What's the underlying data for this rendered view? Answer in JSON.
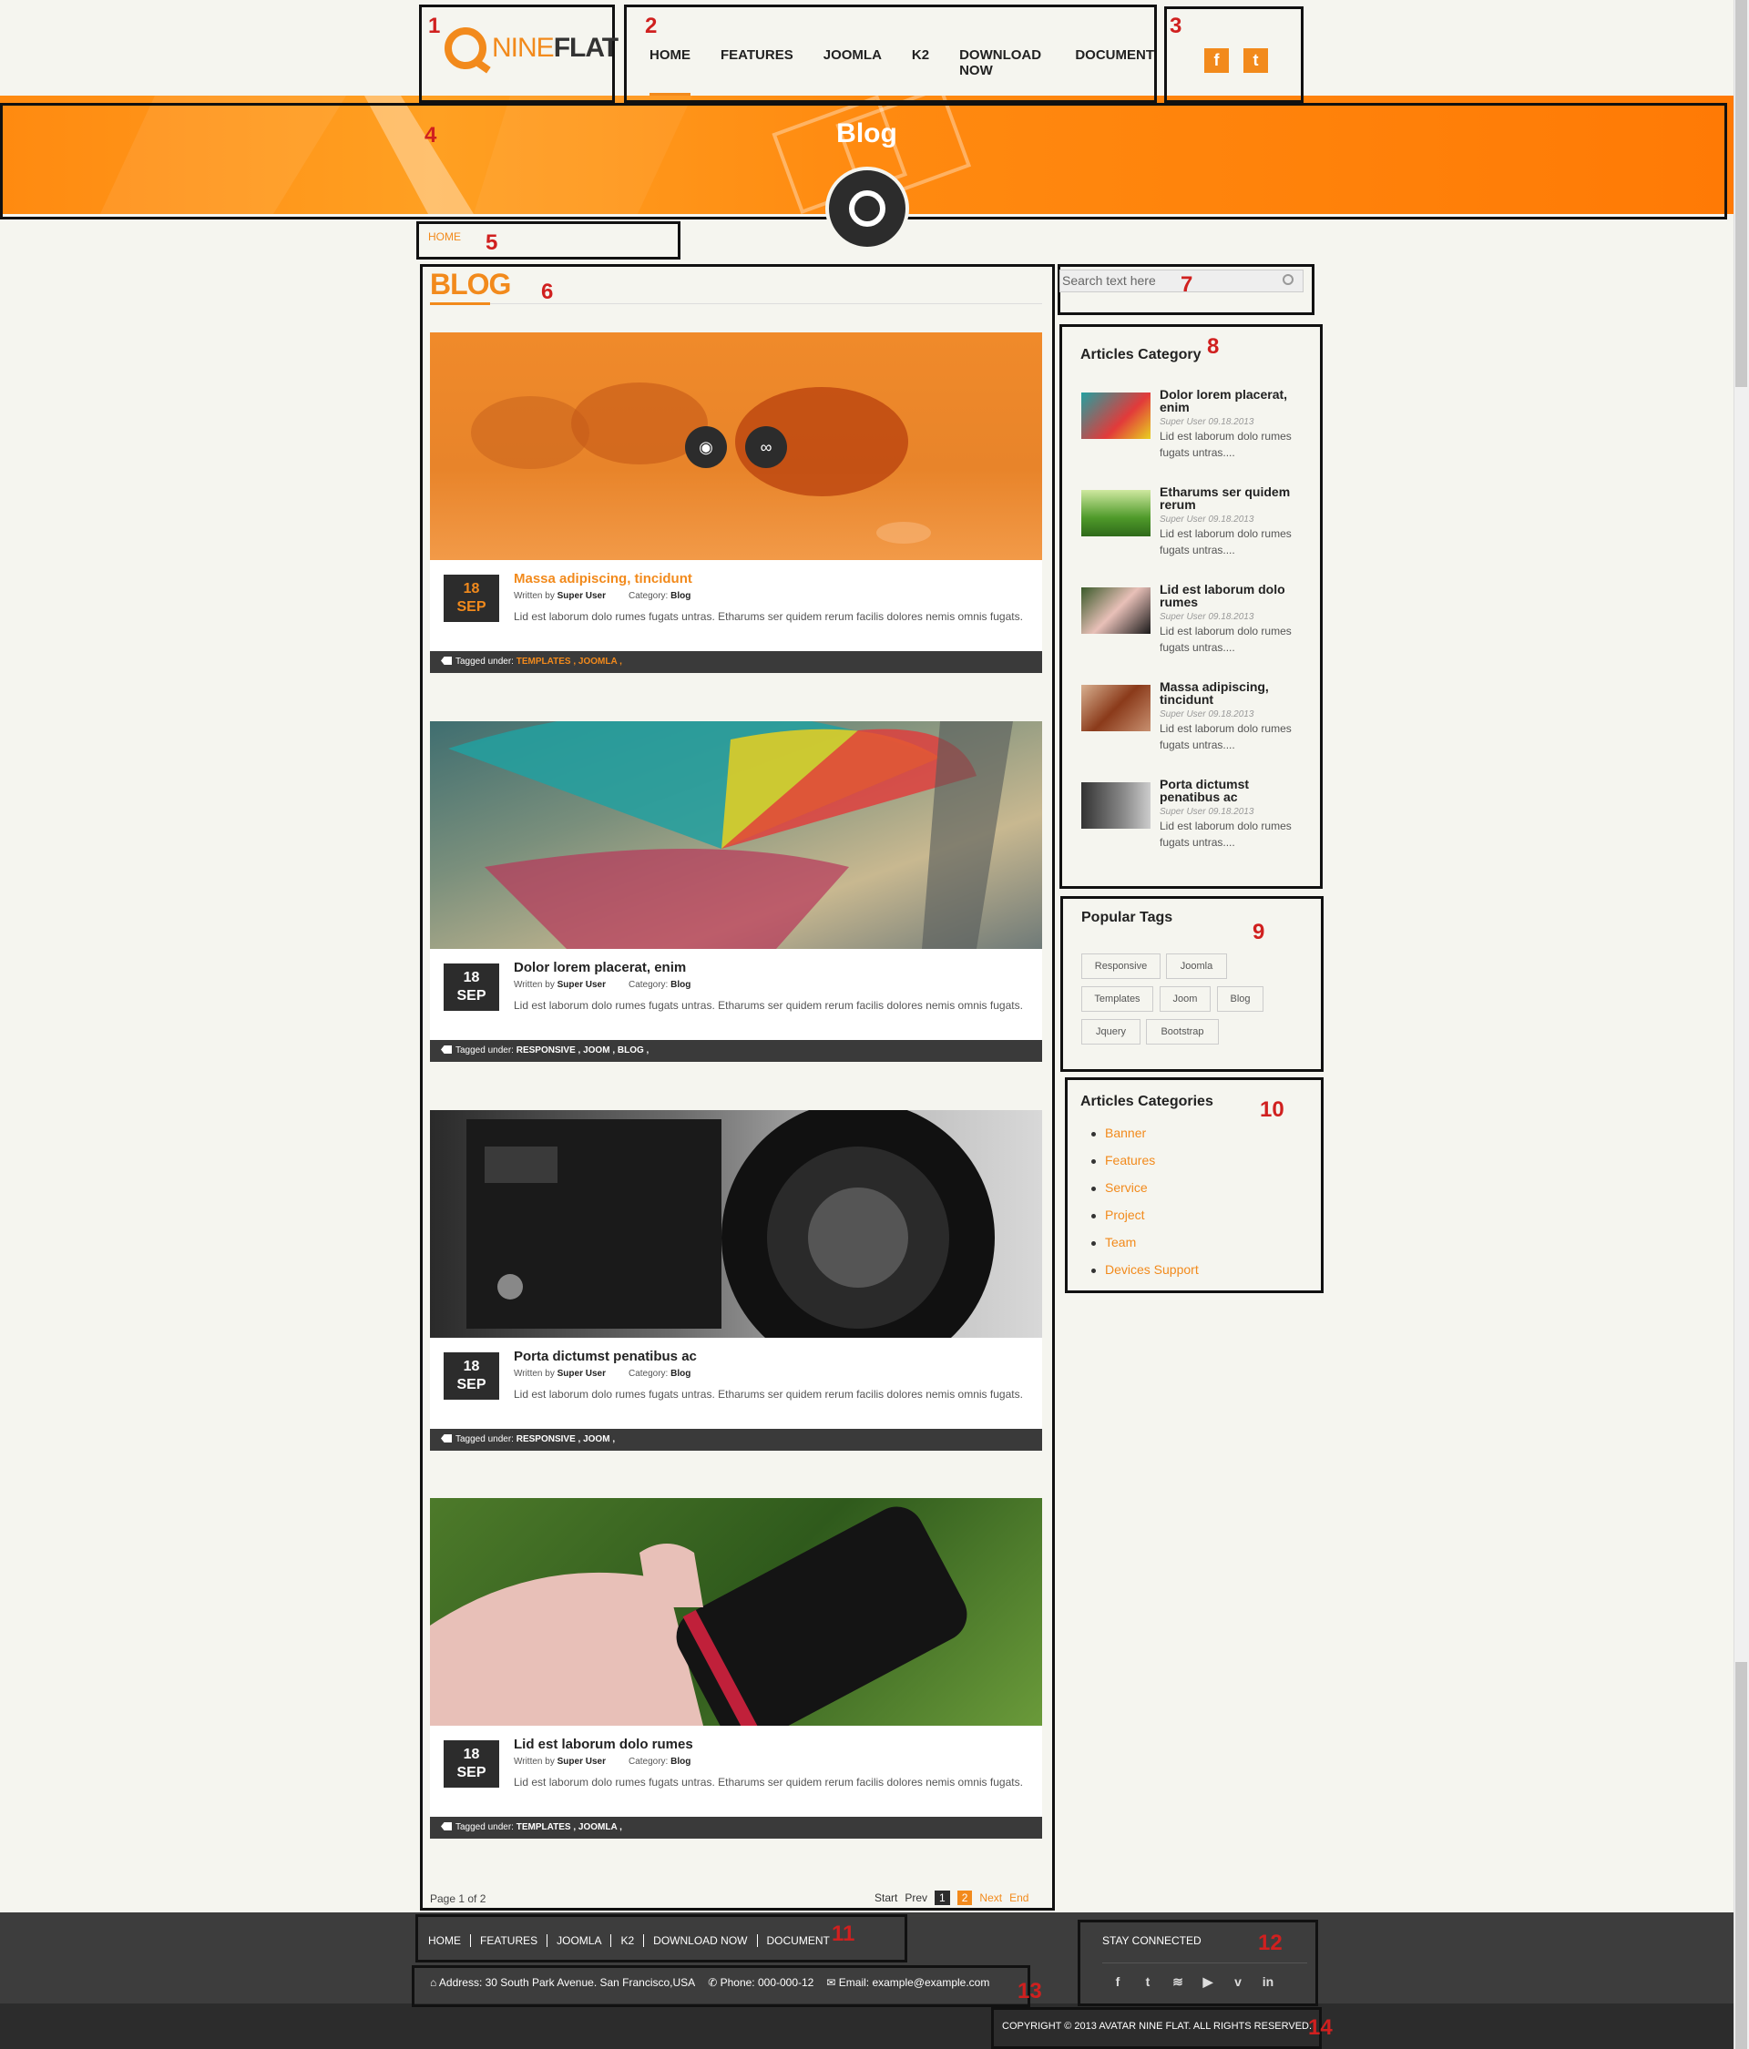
{
  "header": {
    "logo_word1": "NINE",
    "logo_word2": "FLAT",
    "nav": [
      "HOME",
      "FEATURES",
      "JOOMLA",
      "K2",
      "DOWNLOAD NOW",
      "DOCUMENT"
    ],
    "social": [
      "f",
      "t"
    ]
  },
  "banner": {
    "title": "Blog"
  },
  "breadcrumb": "HOME",
  "blog": {
    "heading": "BLOG",
    "articles": [
      {
        "day": "18",
        "month": "SEP",
        "title": "Massa adipiscing, tincidunt",
        "written_by": "Written by",
        "author": "Super User",
        "category_label": "Category:",
        "category": "Blog",
        "text": "Lid est laborum dolo rumes fugats untras. Etharums ser quidem rerum facilis dolores nemis omnis fugats.",
        "tagged": "Tagged under:",
        "tags": "TEMPLATES , JOOMLA ,"
      },
      {
        "day": "18",
        "month": "SEP",
        "title": "Dolor lorem placerat, enim",
        "written_by": "Written by",
        "author": "Super User",
        "category_label": "Category:",
        "category": "Blog",
        "text": "Lid est laborum dolo rumes fugats untras. Etharums ser quidem rerum facilis dolores nemis omnis fugats.",
        "tagged": "Tagged under:",
        "tags": "RESPONSIVE , JOOM , BLOG ,"
      },
      {
        "day": "18",
        "month": "SEP",
        "title": "Porta dictumst penatibus ac",
        "written_by": "Written by",
        "author": "Super User",
        "category_label": "Category:",
        "category": "Blog",
        "text": "Lid est laborum dolo rumes fugats untras. Etharums ser quidem rerum facilis dolores nemis omnis fugats.",
        "tagged": "Tagged under:",
        "tags": "RESPONSIVE , JOOM ,"
      },
      {
        "day": "18",
        "month": "SEP",
        "title": "Lid est laborum dolo rumes",
        "written_by": "Written by",
        "author": "Super User",
        "category_label": "Category:",
        "category": "Blog",
        "text": "Lid est laborum dolo rumes fugats untras. Etharums ser quidem rerum facilis dolores nemis omnis fugats.",
        "tagged": "Tagged under:",
        "tags": "TEMPLATES , JOOMLA ,"
      }
    ],
    "page_info": "Page 1 of 2",
    "pager": {
      "start": "Start",
      "prev": "Prev",
      "page1": "1",
      "page2": "2",
      "next": "Next",
      "end": "End"
    }
  },
  "sidebar": {
    "search_placeholder": "Search text here",
    "articles_category_title": "Articles Category",
    "articles": [
      {
        "title": "Dolor lorem placerat, enim",
        "meta": "Super User 09.18.2013",
        "text": "Lid est laborum dolo rumes fugats untras...."
      },
      {
        "title": "Etharums ser quidem rerum",
        "meta": "Super User 09.18.2013",
        "text": "Lid est laborum dolo rumes fugats untras...."
      },
      {
        "title": "Lid est laborum dolo rumes",
        "meta": "Super User 09.18.2013",
        "text": "Lid est laborum dolo rumes fugats untras...."
      },
      {
        "title": "Massa adipiscing, tincidunt",
        "meta": "Super User 09.18.2013",
        "text": "Lid est laborum dolo rumes fugats untras...."
      },
      {
        "title": "Porta dictumst penatibus ac",
        "meta": "Super User 09.18.2013",
        "text": "Lid est laborum dolo rumes fugats untras...."
      }
    ],
    "popular_tags_title": "Popular Tags",
    "tags": [
      "Responsive",
      "Joomla",
      "Templates",
      "Joom",
      "Blog",
      "Jquery",
      "Bootstrap"
    ],
    "categories_title": "Articles Categories",
    "categories": [
      "Banner",
      "Features",
      "Service",
      "Project",
      "Team",
      "Devices Support"
    ]
  },
  "footer": {
    "nav": [
      "HOME",
      "FEATURES",
      "JOOMLA",
      "K2",
      "DOWNLOAD NOW",
      "DOCUMENT"
    ],
    "stay_connected": "STAY CONNECTED",
    "social": [
      "f",
      "t",
      "rss",
      "yt",
      "v",
      "in"
    ],
    "address": "Address: 30 South Park Avenue. San Francisco,USA",
    "phone": "Phone: 000-000-12",
    "email": "Email: example@example.com",
    "copyright": "COPYRIGHT © 2013 AVATAR NINE FLAT. ALL RIGHTS RESERVED."
  },
  "annotation_numbers": [
    "1",
    "2",
    "3",
    "4",
    "5",
    "6",
    "7",
    "8",
    "9",
    "10",
    "11",
    "12",
    "13",
    "14"
  ],
  "colors": {
    "accent": "#f28a1c",
    "dark": "#2c2c2c",
    "footer": "#3d3d3d",
    "background": "#f5f5ef"
  }
}
